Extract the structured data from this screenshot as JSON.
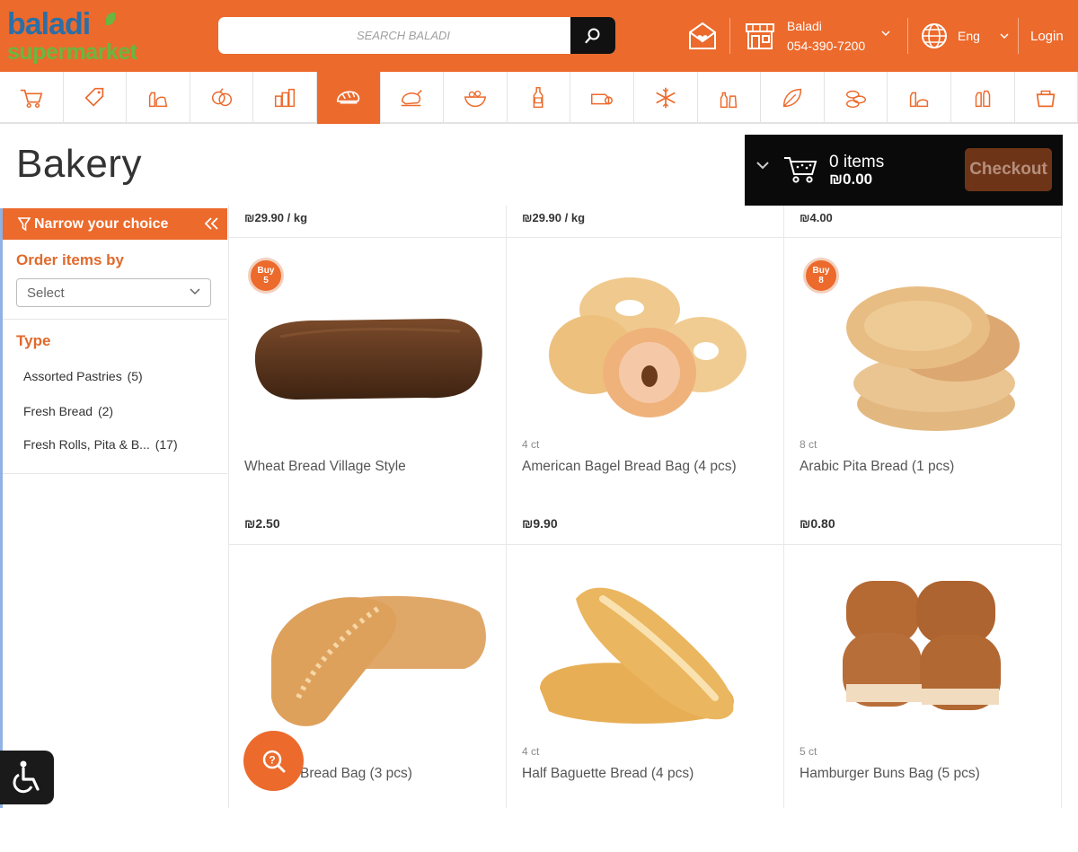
{
  "header": {
    "logo_top": "baladi",
    "logo_bottom": "supermarket",
    "search_placeholder": "SEARCH BALADI",
    "store_name": "Baladi",
    "store_phone": "054-390-7200",
    "language": "Eng",
    "login": "Login",
    "icons": [
      "newsletter-icon",
      "store-icon",
      "globe-icon",
      "search-icon"
    ]
  },
  "categories": [
    {
      "icon": "cart-icon",
      "active": false
    },
    {
      "icon": "tag-icon",
      "active": false
    },
    {
      "icon": "dairy-icon",
      "active": false
    },
    {
      "icon": "produce-icon",
      "active": false
    },
    {
      "icon": "pantry-icon",
      "active": false
    },
    {
      "icon": "bakery-icon",
      "active": true
    },
    {
      "icon": "meat-icon",
      "active": false
    },
    {
      "icon": "salad-icon",
      "active": false
    },
    {
      "icon": "beverages-icon",
      "active": false
    },
    {
      "icon": "deli-icon",
      "active": false
    },
    {
      "icon": "frozen-icon",
      "active": false
    },
    {
      "icon": "bottles-icon",
      "active": false
    },
    {
      "icon": "organic-icon",
      "active": false
    },
    {
      "icon": "snacks-icon",
      "active": false
    },
    {
      "icon": "baby-icon",
      "active": false
    },
    {
      "icon": "household-icon",
      "active": false
    },
    {
      "icon": "kitchen-icon",
      "active": false
    }
  ],
  "page": {
    "title": "Bakery"
  },
  "cart": {
    "count": "0 items",
    "total": "₪0.00",
    "checkout": "Checkout"
  },
  "sidebar": {
    "header": "Narrow your choice",
    "order_title": "Order items by",
    "order_select": "Select",
    "type_title": "Type",
    "types": [
      {
        "label": "Assorted Pastries",
        "count": "(5)"
      },
      {
        "label": "Fresh Bread",
        "count": "(2)"
      },
      {
        "label": "Fresh Rolls, Pita & B...",
        "count": "(17)"
      }
    ]
  },
  "top_prices": [
    "₪29.90 / kg",
    "₪29.90 / kg",
    "₪4.00"
  ],
  "products": [
    {
      "name": "Wheat Bread Village Style",
      "qty": "",
      "price": "₪2.50",
      "badge": "Buy 5"
    },
    {
      "name": "American Bagel Bread Bag (4 pcs)",
      "qty": "4 ct",
      "price": "₪9.90",
      "badge": ""
    },
    {
      "name": "Arabic Pita Bread (1 pcs)",
      "qty": "8 ct",
      "price": "₪0.80",
      "badge": "Buy 8"
    },
    {
      "name": "Bread Bag (3 pcs)",
      "qty": "",
      "price": "",
      "badge": ""
    },
    {
      "name": "Half Baguette Bread (4 pcs)",
      "qty": "4 ct",
      "price": "",
      "badge": ""
    },
    {
      "name": "Hamburger Buns Bag (5 pcs)",
      "qty": "5 ct",
      "price": "",
      "badge": ""
    }
  ],
  "colors": {
    "brand_orange": "#ec6a2c",
    "logo_blue": "#2c6fa6",
    "logo_green": "#6ab640",
    "cart_bg": "#0a0a0a"
  }
}
